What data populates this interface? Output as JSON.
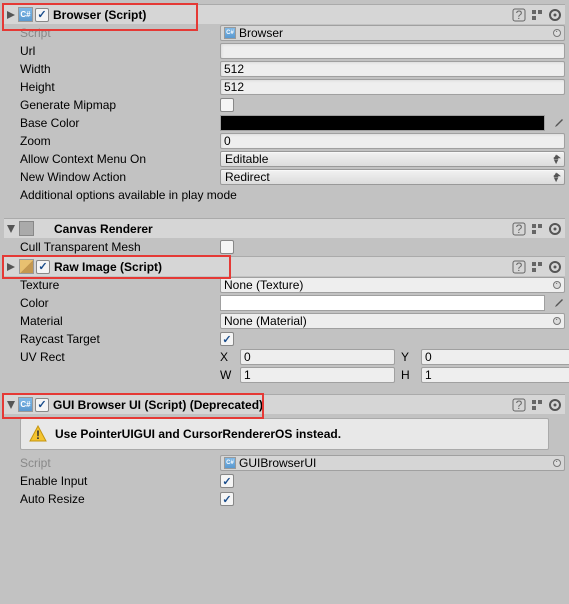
{
  "browser": {
    "title": "Browser (Script)",
    "enabled": true,
    "rows": {
      "script": {
        "label": "Script",
        "value": "Browser"
      },
      "url": {
        "label": "Url",
        "value": ""
      },
      "width": {
        "label": "Width",
        "value": "512"
      },
      "height": {
        "label": "Height",
        "value": "512"
      },
      "generateMipmap": {
        "label": "Generate Mipmap",
        "value": false
      },
      "baseColor": {
        "label": "Base Color",
        "value": "#000000"
      },
      "zoom": {
        "label": "Zoom",
        "value": "0"
      },
      "allowContextMenuOn": {
        "label": "Allow Context Menu On",
        "value": "Editable"
      },
      "newWindowAction": {
        "label": "New Window Action",
        "value": "Redirect"
      }
    },
    "note": "Additional options available in play mode"
  },
  "canvasRenderer": {
    "title": "Canvas Renderer",
    "rows": {
      "cullTransparentMesh": {
        "label": "Cull Transparent Mesh",
        "value": false
      }
    }
  },
  "rawImage": {
    "title": "Raw Image (Script)",
    "enabled": true,
    "rows": {
      "texture": {
        "label": "Texture",
        "value": "None (Texture)"
      },
      "color": {
        "label": "Color",
        "value": "#ffffff"
      },
      "material": {
        "label": "Material",
        "value": "None (Material)"
      },
      "raycastTarget": {
        "label": "Raycast Target",
        "value": true
      },
      "uvRect": {
        "label": "UV Rect",
        "x": "0",
        "y": "0",
        "w": "1",
        "h": "1"
      }
    }
  },
  "guiBrowserUI": {
    "title": "GUI Browser UI (Script)",
    "deprecated": "(Deprecated)",
    "enabled": true,
    "warning": "Use PointerUIGUI and CursorRendererOS instead.",
    "rows": {
      "script": {
        "label": "Script",
        "value": "GUIBrowserUI"
      },
      "enableInput": {
        "label": "Enable Input",
        "value": true
      },
      "autoResize": {
        "label": "Auto Resize",
        "value": true
      }
    }
  }
}
